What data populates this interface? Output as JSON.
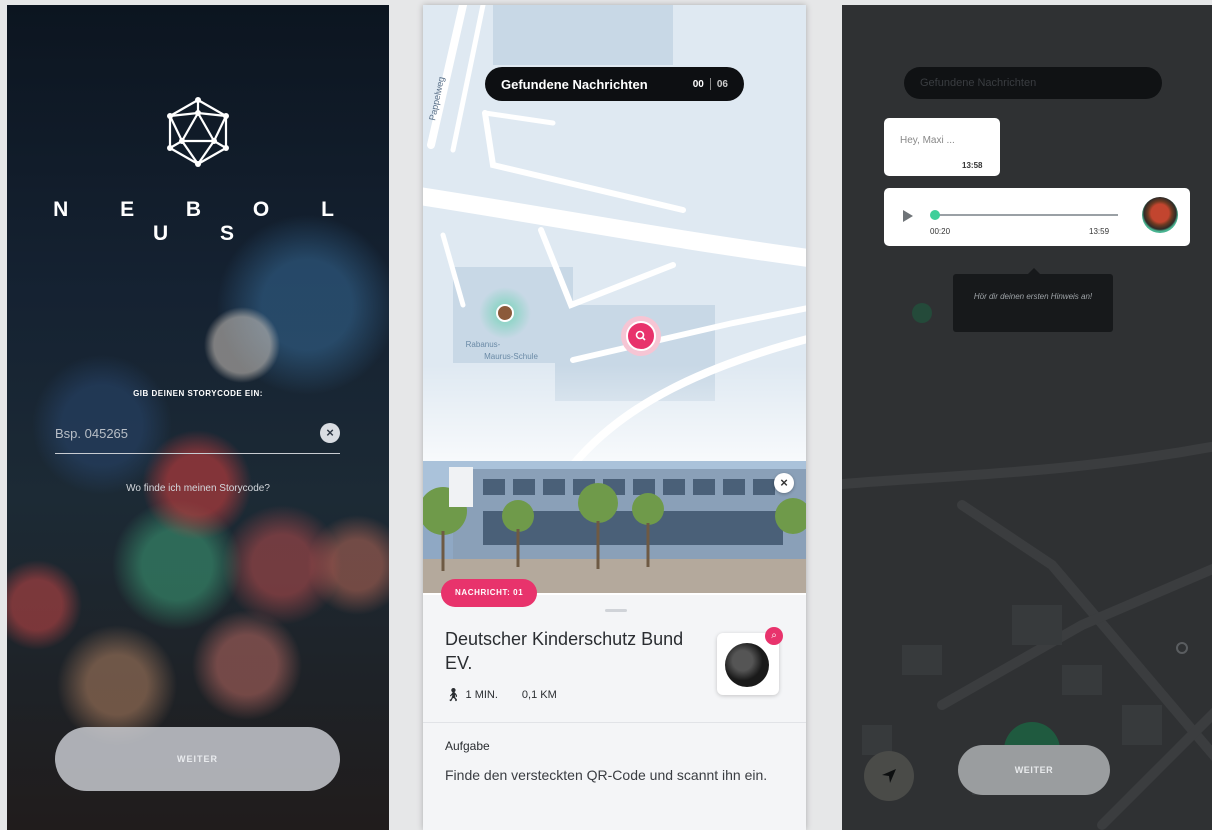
{
  "login": {
    "brand": "N E B O L U S",
    "prompt_label": "GIB DEINEN STORYCODE EIN:",
    "code_placeholder": "Bsp. 045265",
    "help_link": "Wo finde ich meinen Storycode?",
    "continue_button": "WEITER",
    "clear_icon": "close-icon",
    "logo_icon": "polyhedron-logo-icon"
  },
  "map": {
    "found_messages_label": "Gefundene Nachrichten",
    "found_count": "00",
    "total_count": "06",
    "street_label": "Pappelweg",
    "school_label": "Rabanus-Maurus-Schule",
    "message_badge": "NACHRICHT: 01",
    "place": {
      "title": "Deutscher Kinderschutz Bund EV.",
      "walk_time": "1 MIN.",
      "distance": "0,1 KM"
    },
    "task": {
      "label": "Aufgabe",
      "text": "Finde den versteckten QR-Code und scannt ihn ein."
    },
    "accent_color": "#e8336c",
    "user_color": "#3ecf9a"
  },
  "chat": {
    "message1": {
      "text": "Hey, Maxi ...",
      "time": "13:58"
    },
    "voice": {
      "elapsed": "00:20",
      "time": "13:59"
    },
    "tooltip": "Hör dir deinen ersten Hinweis an!",
    "continue_button": "WEITER",
    "locate_icon": "navigation-arrow-icon"
  }
}
